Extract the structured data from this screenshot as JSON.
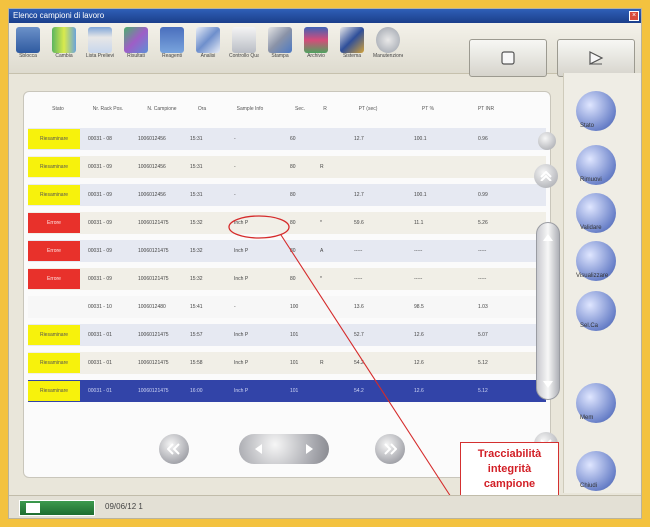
{
  "window": {
    "title": "Elenco campioni di lavoro"
  },
  "toolbar": {
    "tools": [
      {
        "label": "Sblocca",
        "icon": "lab-person-icon"
      },
      {
        "label": "Cambia",
        "icon": "tubes-icon"
      },
      {
        "label": "Lista Prelievi",
        "icon": "racks-icon"
      },
      {
        "label": "Risultati",
        "icon": "chart-icon"
      },
      {
        "label": "Reagenti",
        "icon": "users-icon"
      },
      {
        "label": "Analisi",
        "icon": "lines-icon"
      },
      {
        "label": "Controllo Qualità",
        "icon": "document-icon"
      },
      {
        "label": "Stampa",
        "icon": "tools-icon"
      },
      {
        "label": "Archivio",
        "icon": "book-icon"
      },
      {
        "label": "Sistema",
        "icon": "key-icon"
      },
      {
        "label": "Manutenzione",
        "icon": "disc-icon"
      }
    ],
    "stop_button": "stop-icon",
    "start_button": "play-icon"
  },
  "table": {
    "headers": [
      "Stato",
      "Nr. Rack Pos.",
      "N. Campione",
      "Ora",
      "Sample Info",
      "Sec.",
      "R",
      "PT (sec)",
      "PT %",
      "PT INR"
    ],
    "rows": [
      {
        "status": "Riesaminare",
        "rack": "00031 - 08",
        "sample": "1006012456",
        "time": "15:31",
        "info": "-",
        "sec": "60",
        "r": "",
        "pt_sec": "12.7",
        "pt_pct": "100.1",
        "inr": "0.96",
        "bg": "#e6e9f2",
        "status_color": "#f7f20c"
      },
      {
        "status": "Riesaminare",
        "rack": "00031 - 09",
        "sample": "1006012456",
        "time": "15:31",
        "info": "-",
        "sec": "80",
        "r": "R",
        "pt_sec": "",
        "pt_pct": "",
        "inr": "",
        "bg": "#f1efe7",
        "status_color": "#f7f20c"
      },
      {
        "status": "Riesaminare",
        "rack": "00031 - 09",
        "sample": "1006012456",
        "time": "15:31",
        "info": "-",
        "sec": "80",
        "r": "",
        "pt_sec": "12.7",
        "pt_pct": "100.1",
        "inr": "0.99",
        "bg": "#e6e9f2",
        "status_color": "#f7f20c"
      },
      {
        "status": "Errore",
        "rack": "00031 - 09",
        "sample": "10060121475",
        "time": "15:32",
        "info": "Inch P",
        "sec": "80",
        "r": "*",
        "pt_sec": "59.6",
        "pt_pct": "11.1",
        "inr": "5.26",
        "bg": "#f1efe7",
        "status_color": "#e8312b"
      },
      {
        "status": "Errore",
        "rack": "00031 - 09",
        "sample": "10060121475",
        "time": "15:32",
        "info": "Inch P",
        "sec": "80",
        "r": "A",
        "pt_sec": "-----",
        "pt_pct": "-----",
        "inr": "-----",
        "bg": "#e6e9f2",
        "status_color": "#e8312b"
      },
      {
        "status": "Errore",
        "rack": "00031 - 09",
        "sample": "10060121475",
        "time": "15:32",
        "info": "Inch P",
        "sec": "80",
        "r": "*",
        "pt_sec": "-----",
        "pt_pct": "-----",
        "inr": "-----",
        "bg": "#f1efe7",
        "status_color": "#e8312b"
      },
      {
        "status": "",
        "rack": "00031 - 10",
        "sample": "1006012480",
        "time": "15:41",
        "info": "-",
        "sec": "100",
        "r": "",
        "pt_sec": "13.6",
        "pt_pct": "98.5",
        "inr": "1.03",
        "bg": "#f7f7f7",
        "status_color": "#f7f7f7"
      },
      {
        "status": "Riesaminare",
        "rack": "00031 - 01",
        "sample": "10060121475",
        "time": "15:57",
        "info": "Inch P",
        "sec": "101",
        "r": "",
        "pt_sec": "52.7",
        "pt_pct": "12.6",
        "inr": "5.07",
        "bg": "#e6e9f2",
        "status_color": "#f7f20c"
      },
      {
        "status": "Riesaminare",
        "rack": "00031 - 01",
        "sample": "10060121475",
        "time": "15:58",
        "info": "Inch P",
        "sec": "101",
        "r": "R",
        "pt_sec": "54.2",
        "pt_pct": "12.6",
        "inr": "5.12",
        "bg": "#f1efe7",
        "status_color": "#f7f20c"
      },
      {
        "status": "Riesaminare",
        "rack": "00031 - 01",
        "sample": "10060121475",
        "time": "16:00",
        "info": "Inch P",
        "sec": "101",
        "r": "",
        "pt_sec": "54.2",
        "pt_pct": "12.6",
        "inr": "5.12",
        "bg": "#3244a8",
        "status_color": "#f7f20c"
      }
    ]
  },
  "right_buttons": [
    {
      "label": "Stato"
    },
    {
      "label": "Rimuovi"
    },
    {
      "label": "Validare"
    },
    {
      "label": "Visualizzare"
    },
    {
      "label": "Sel.Ca"
    },
    {
      "label": "Mem"
    },
    {
      "label": "Chiudi"
    }
  ],
  "annotation": {
    "line1": "Tracciabilità",
    "line2": "integrità",
    "line3": "campione"
  },
  "bottom": {
    "status": "09/06/12 1"
  }
}
